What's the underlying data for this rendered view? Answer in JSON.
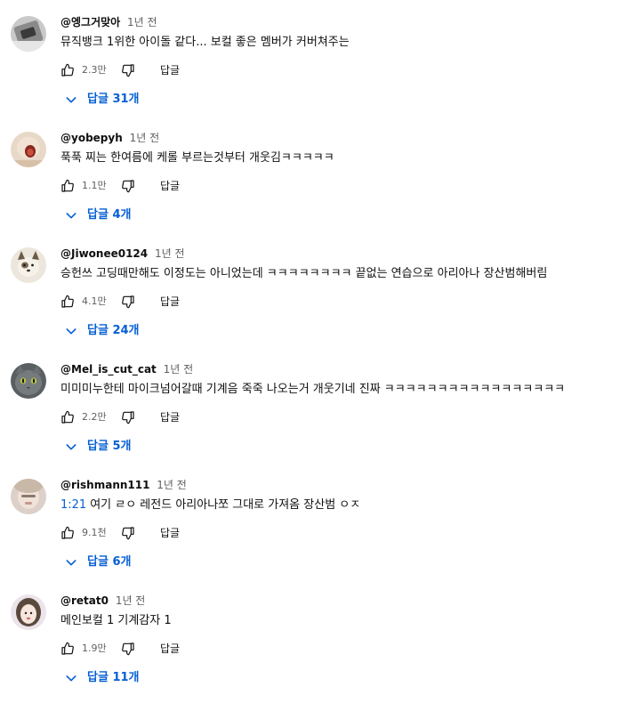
{
  "ui": {
    "reply_label": "답글",
    "link_color": "#065fd4",
    "meta_color": "#606060",
    "like_icon": "thumbs-up-icon",
    "dislike_icon": "thumbs-down-icon",
    "expand_icon": "chevron-down-icon"
  },
  "comments": [
    {
      "author": "@엥그거맞아",
      "time": "1년 전",
      "timestamp": "",
      "text": "뮤직뱅크 1위한 아이돌 같다... 보컬 좋은 멤버가 커버쳐주는",
      "likes": "2.3만",
      "replies_label": "답글 31개"
    },
    {
      "author": "@yobepyh",
      "time": "1년 전",
      "timestamp": "",
      "text": "푹푹 찌는 한여름에 케롤 부르는것부터 개웃김ㅋㅋㅋㅋㅋ",
      "likes": "1.1만",
      "replies_label": "답글 4개"
    },
    {
      "author": "@Jiwonee0124",
      "time": "1년 전",
      "timestamp": "",
      "text": "승헌쓰 고딩때만해도 이정도는 아니었는데 ㅋㅋㅋㅋㅋㅋㅋㅋ 끝없는 연습으로 아리아나 장산범해버림",
      "likes": "4.1만",
      "replies_label": "답글 24개"
    },
    {
      "author": "@Mel_is_cut_cat",
      "time": "1년 전",
      "timestamp": "",
      "text": "미미미누한테 마이크넘어갈때 기계음 죽죽 나오는거 개웃기네 진짜 ㅋㅋㅋㅋㅋㅋㅋㅋㅋㅋㅋㅋㅋㅋㅋㅋㅋ",
      "likes": "2.2만",
      "replies_label": "답글 5개"
    },
    {
      "author": "@rishmann111",
      "time": "1년 전",
      "timestamp": "1:21",
      "text": "여기 ㄹㅇ 레전드 아리아나쪼 그대로 가져옴 장산범 ㅇㅈ",
      "likes": "9.1천",
      "replies_label": "답글 6개"
    },
    {
      "author": "@retat0",
      "time": "1년 전",
      "timestamp": "",
      "text": "메인보컬 1 기계감자 1",
      "likes": "1.9만",
      "replies_label": "답글 11개"
    }
  ]
}
